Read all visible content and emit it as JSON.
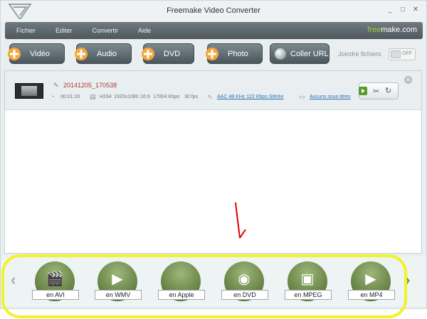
{
  "window": {
    "title": "Freemake Video Converter",
    "controls": [
      "_",
      "□",
      "✕"
    ]
  },
  "menu": {
    "items": [
      "Fichier",
      "Editer",
      "Convertir",
      "Aide"
    ],
    "brand_main": "free",
    "brand_accent": "make",
    "brand_suffix": ".com"
  },
  "toolbar": {
    "video": "Vidéo",
    "audio": "Audio",
    "dvd": "DVD",
    "photo": "Photo",
    "url": "Coller URL",
    "join_label": "Joindre fichiers",
    "toggle_state": "OFF"
  },
  "file": {
    "name": "20141205_170538",
    "duration": "00:01:20",
    "codec": "H264",
    "resolution": "1920x1080",
    "aspect": "16:9",
    "bitrate": "17004 Kbps",
    "fps": "30 fps",
    "audio": "AAC  48 KHz  122 Kbps  Stéréo",
    "subtitles": "Aucuns sous-titres"
  },
  "formats": [
    {
      "label": "en AVI",
      "icon": "clapper-icon"
    },
    {
      "label": "en WMV",
      "icon": "media-player-icon"
    },
    {
      "label": "en Apple",
      "icon": "apple-icon"
    },
    {
      "label": "en DVD",
      "icon": "disc-icon"
    },
    {
      "label": "en MPEG",
      "icon": "tv-icon"
    },
    {
      "label": "en MP4",
      "icon": "mp4-icon"
    }
  ],
  "colors": {
    "accent_green": "#9bd032",
    "filename_red": "#b03a2e",
    "link_blue": "#2b6fae",
    "highlight_yellow": "#f1f32a",
    "annotation_red": "#e00000"
  }
}
